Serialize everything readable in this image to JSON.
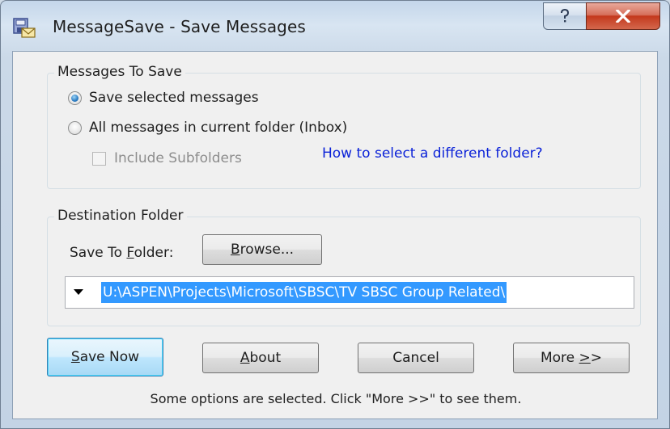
{
  "window": {
    "title": "MessageSave - Save Messages"
  },
  "messages_group": {
    "label": "Messages To Save",
    "option_selected": "Save selected messages",
    "option_all": "All messages in current folder (Inbox)",
    "include_subfolders": "Include Subfolders",
    "help_link": "How to select a different folder?"
  },
  "destination_group": {
    "label": "Destination Folder",
    "save_to_label_prefix": "Save To ",
    "save_to_label_u": "F",
    "save_to_label_suffix": "older:",
    "browse_u": "B",
    "browse_rest": "rowse...",
    "folder_path": "U:\\ASPEN\\Projects\\Microsoft\\SBSC\\TV SBSC Group Related\\"
  },
  "buttons": {
    "save_now_u": "S",
    "save_now_rest": "ave Now",
    "about_u": "A",
    "about_rest": "bout",
    "cancel": "Cancel",
    "more_prefix": "More ",
    "more_u": ">",
    "more_suffix": ">"
  },
  "status_text": "Some options are selected. Click \"More >>\" to see them.",
  "icons": [
    "app-icon",
    "help-icon",
    "close-icon",
    "dropdown-arrow-icon"
  ]
}
